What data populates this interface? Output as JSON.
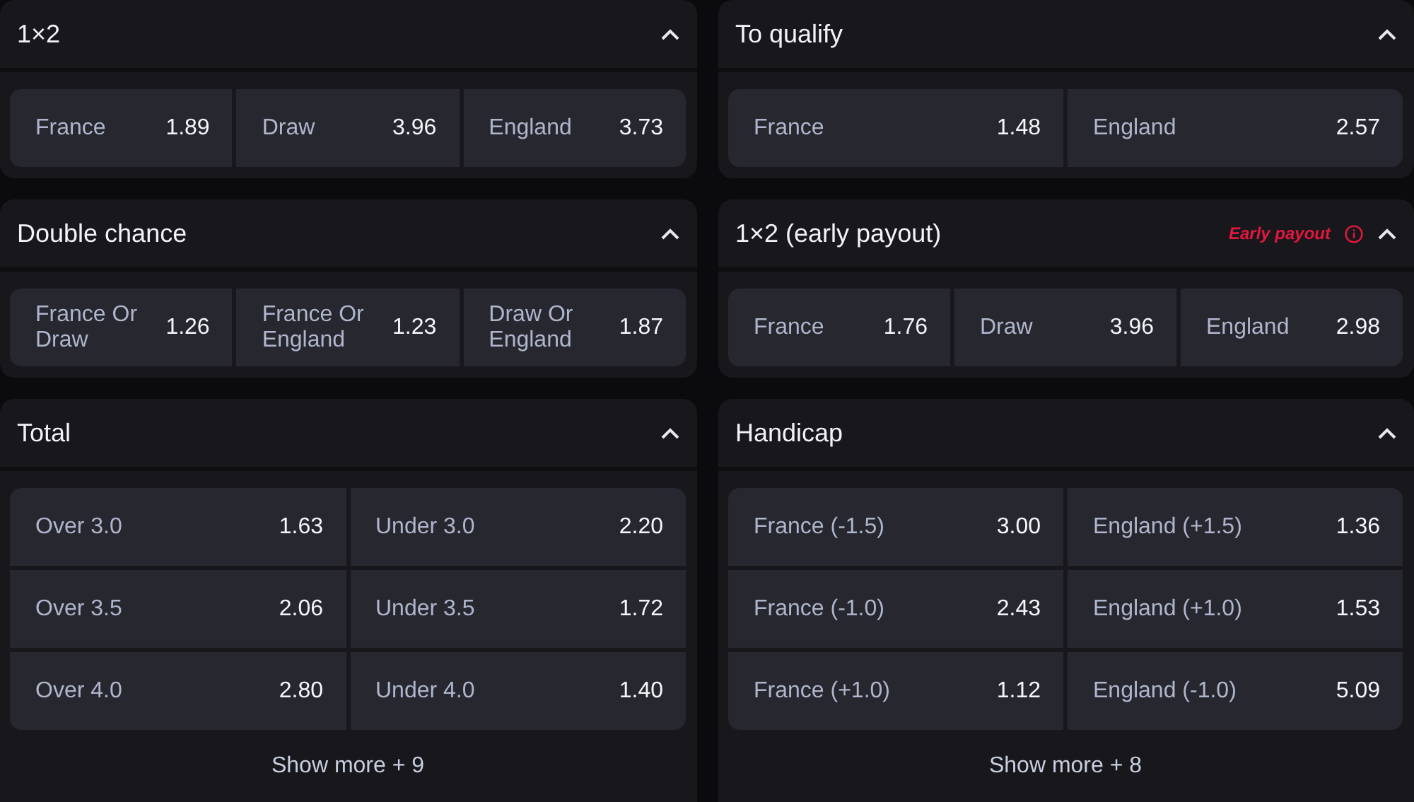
{
  "markets": [
    {
      "title": "1×2",
      "outcomes": [
        {
          "label": "France",
          "odds": "1.89"
        },
        {
          "label": "Draw",
          "odds": "3.96"
        },
        {
          "label": "England",
          "odds": "3.73"
        }
      ]
    },
    {
      "title": "To qualify",
      "outcomes": [
        {
          "label": "France",
          "odds": "1.48"
        },
        {
          "label": "England",
          "odds": "2.57"
        }
      ]
    },
    {
      "title": "Double chance",
      "outcomes": [
        {
          "label": "France Or Draw",
          "odds": "1.26"
        },
        {
          "label": "France Or England",
          "odds": "1.23"
        },
        {
          "label": "Draw Or England",
          "odds": "1.87"
        }
      ]
    },
    {
      "title": "1×2 (early payout)",
      "badge": "Early payout",
      "outcomes": [
        {
          "label": "France",
          "odds": "1.76"
        },
        {
          "label": "Draw",
          "odds": "3.96"
        },
        {
          "label": "England",
          "odds": "2.98"
        }
      ]
    },
    {
      "title": "Total",
      "outcomes": [
        {
          "label": "Over 3.0",
          "odds": "1.63"
        },
        {
          "label": "Under 3.0",
          "odds": "2.20"
        },
        {
          "label": "Over 3.5",
          "odds": "2.06"
        },
        {
          "label": "Under 3.5",
          "odds": "1.72"
        },
        {
          "label": "Over 4.0",
          "odds": "2.80"
        },
        {
          "label": "Under 4.0",
          "odds": "1.40"
        }
      ],
      "show_more": "Show more + 9"
    },
    {
      "title": "Handicap",
      "outcomes": [
        {
          "label": "France (-1.5)",
          "odds": "3.00"
        },
        {
          "label": "England (+1.5)",
          "odds": "1.36"
        },
        {
          "label": "France (-1.0)",
          "odds": "2.43"
        },
        {
          "label": "England (+1.0)",
          "odds": "1.53"
        },
        {
          "label": "France (+1.0)",
          "odds": "1.12"
        },
        {
          "label": "England (-1.0)",
          "odds": "5.09"
        }
      ],
      "show_more": "Show more + 8"
    }
  ]
}
